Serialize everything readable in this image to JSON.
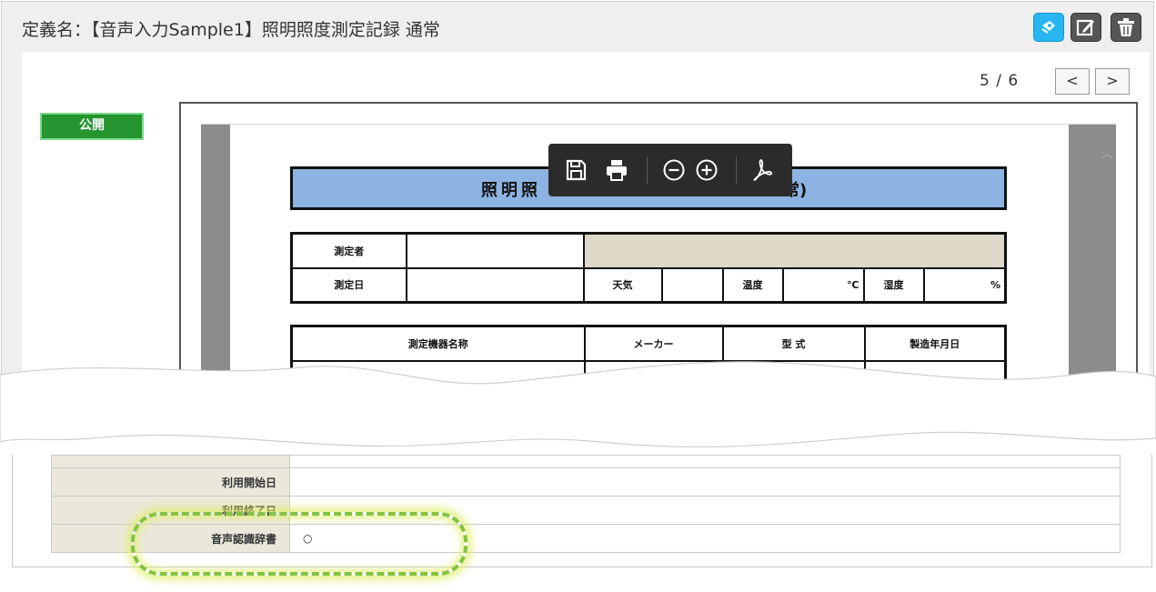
{
  "header": {
    "title": "定義名：【音声入力Sample1】照明照度測定記録 通常"
  },
  "pager": {
    "indicator": "5 / 6",
    "prev_label": "<",
    "next_label": ">"
  },
  "status": {
    "public_label": "公開"
  },
  "document": {
    "title_left": "照明照",
    "title_right": "常)",
    "info_rows": {
      "measurer": "測定者",
      "date": "測定日",
      "weather": "天気",
      "temperature": "温度",
      "temp_unit": "℃",
      "humidity": "湿度",
      "humidity_unit": "%"
    },
    "equipment_headers": [
      "測定機器名称",
      "メーカー",
      "型 式",
      "製造年月日"
    ]
  },
  "properties": [
    {
      "label": "利用開始日",
      "value": ""
    },
    {
      "label": "利用終了日",
      "value": ""
    },
    {
      "label": "音声認識辞書",
      "value": "○"
    }
  ],
  "icons": {
    "header": [
      "share-icon",
      "edit-icon",
      "trash-icon"
    ],
    "toolbar": [
      "save-icon",
      "print-icon",
      "zoom-out-icon",
      "zoom-in-icon",
      "pdf-icon"
    ]
  },
  "colors": {
    "share_button": "#27b6f0",
    "public_badge": "#24952f",
    "doc_title_bar": "#8db3e2",
    "label_cell": "#ebe8db",
    "highlight": "#82c341"
  }
}
